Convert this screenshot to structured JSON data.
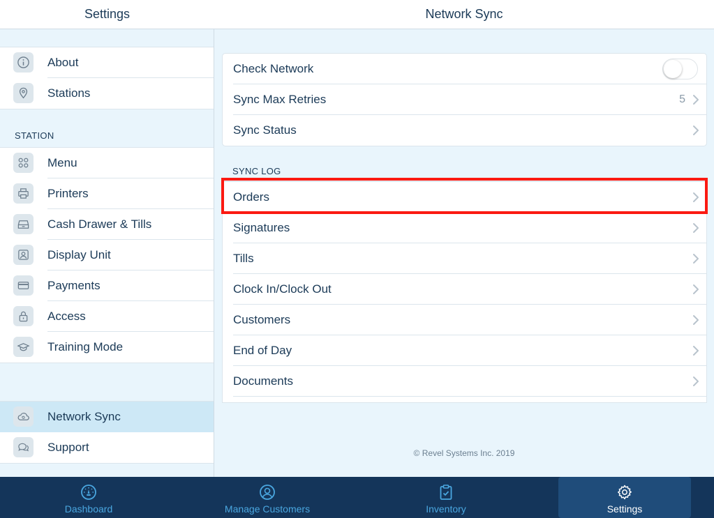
{
  "header": {
    "left_title": "Settings",
    "right_title": "Network Sync"
  },
  "sidebar": {
    "top_items": [
      {
        "label": "About",
        "icon": "info-icon"
      },
      {
        "label": "Stations",
        "icon": "location-pin-icon"
      }
    ],
    "station_section_label": "STATION",
    "station_items": [
      {
        "label": "Menu",
        "icon": "grid-icon"
      },
      {
        "label": "Printers",
        "icon": "printer-icon"
      },
      {
        "label": "Cash Drawer & Tills",
        "icon": "cash-drawer-icon"
      },
      {
        "label": "Display Unit",
        "icon": "display-unit-icon"
      },
      {
        "label": "Payments",
        "icon": "card-icon"
      },
      {
        "label": "Access",
        "icon": "lock-icon"
      },
      {
        "label": "Training Mode",
        "icon": "graduation-cap-icon"
      }
    ],
    "bottom_items": [
      {
        "label": "Network Sync",
        "icon": "cloud-sync-icon",
        "active": true
      },
      {
        "label": "Support",
        "icon": "chat-bubbles-icon"
      }
    ]
  },
  "main": {
    "settings_rows": [
      {
        "label": "Check Network",
        "control": "toggle",
        "on": false
      },
      {
        "label": "Sync Max Retries",
        "value": "5"
      },
      {
        "label": "Sync Status"
      }
    ],
    "sync_log_label": "SYNC LOG",
    "sync_log_rows": [
      {
        "label": "Orders",
        "highlighted": true
      },
      {
        "label": "Signatures"
      },
      {
        "label": "Tills"
      },
      {
        "label": "Clock In/Clock Out"
      },
      {
        "label": "Customers"
      },
      {
        "label": "End of Day"
      },
      {
        "label": "Documents"
      }
    ],
    "footer": "© Revel Systems Inc. 2019"
  },
  "tabbar": {
    "tabs": [
      {
        "label": "Dashboard",
        "icon": "dashboard-gauge-icon"
      },
      {
        "label": "Manage Customers",
        "icon": "user-circle-icon"
      },
      {
        "label": "Inventory",
        "icon": "clipboard-check-icon"
      },
      {
        "label": "Settings",
        "icon": "gear-icon",
        "active": true
      }
    ]
  },
  "colors": {
    "accent": "#4aa7e0",
    "tabbar_bg": "#14355a",
    "active_sidebar": "#cde8f6",
    "highlight_box": "#fb1a12"
  }
}
